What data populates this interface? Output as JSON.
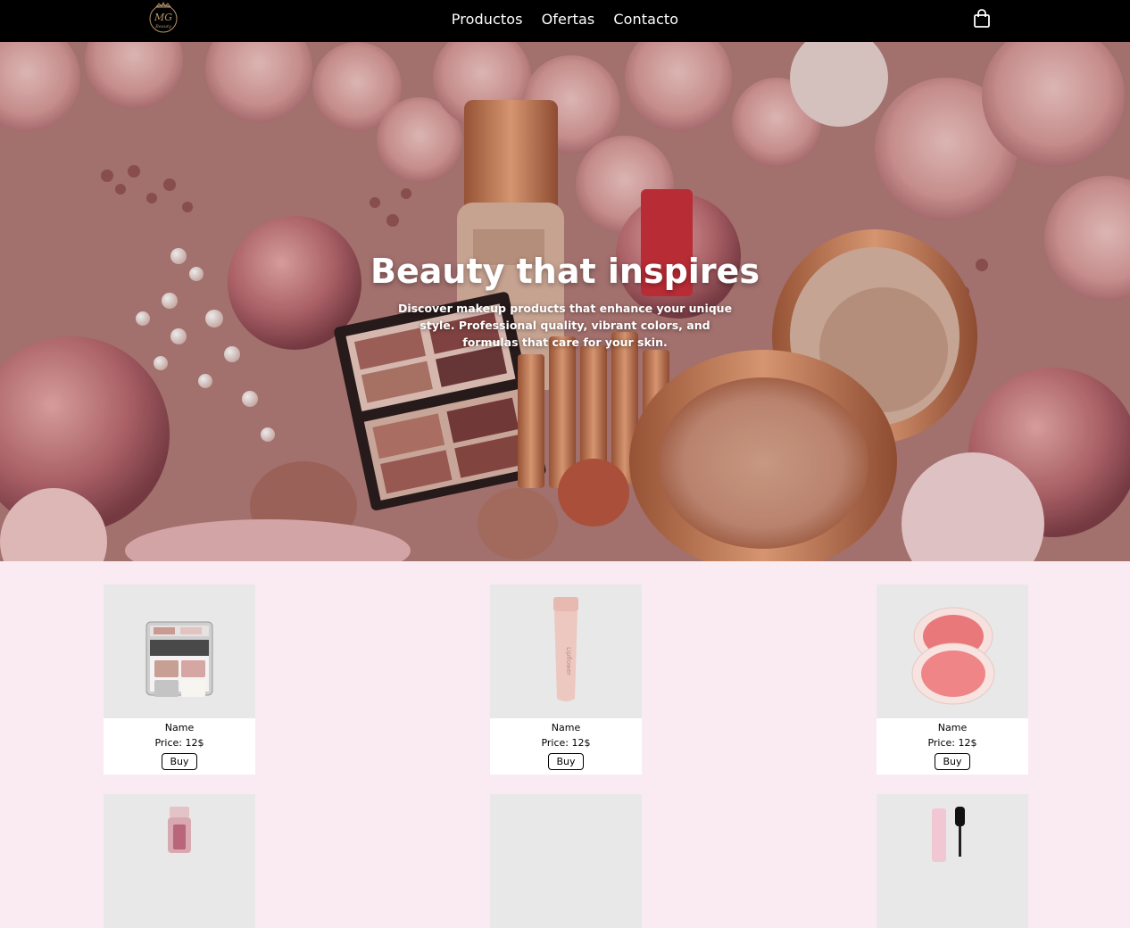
{
  "header": {
    "logo_text": "MG Beauty",
    "nav": [
      {
        "label": "Productos"
      },
      {
        "label": "Ofertas"
      },
      {
        "label": "Contacto"
      }
    ],
    "cart_icon": "shopping-bag-icon"
  },
  "hero": {
    "title": "Beauty that inspires",
    "subtitle": "Discover makeup products that enhance your unique style. Professional quality, vibrant colors, and formulas that care for your skin."
  },
  "products": [
    {
      "image": "eyeshadow-palette",
      "name": "Name",
      "price": "Price: 12$",
      "button": "Buy"
    },
    {
      "image": "lip-gloss-tube",
      "name": "Name",
      "price": "Price: 12$",
      "button": "Buy"
    },
    {
      "image": "blush-compact",
      "name": "Name",
      "price": "Price: 12$",
      "button": "Buy"
    },
    {
      "image": "lip-oil-bottle"
    },
    {
      "image": "blank"
    },
    {
      "image": "mascara"
    }
  ],
  "colors": {
    "header_bg": "#000000",
    "page_bg": "#faebf2",
    "card_bg": "#ffffff",
    "product_img_bg": "#e9e8e8"
  }
}
